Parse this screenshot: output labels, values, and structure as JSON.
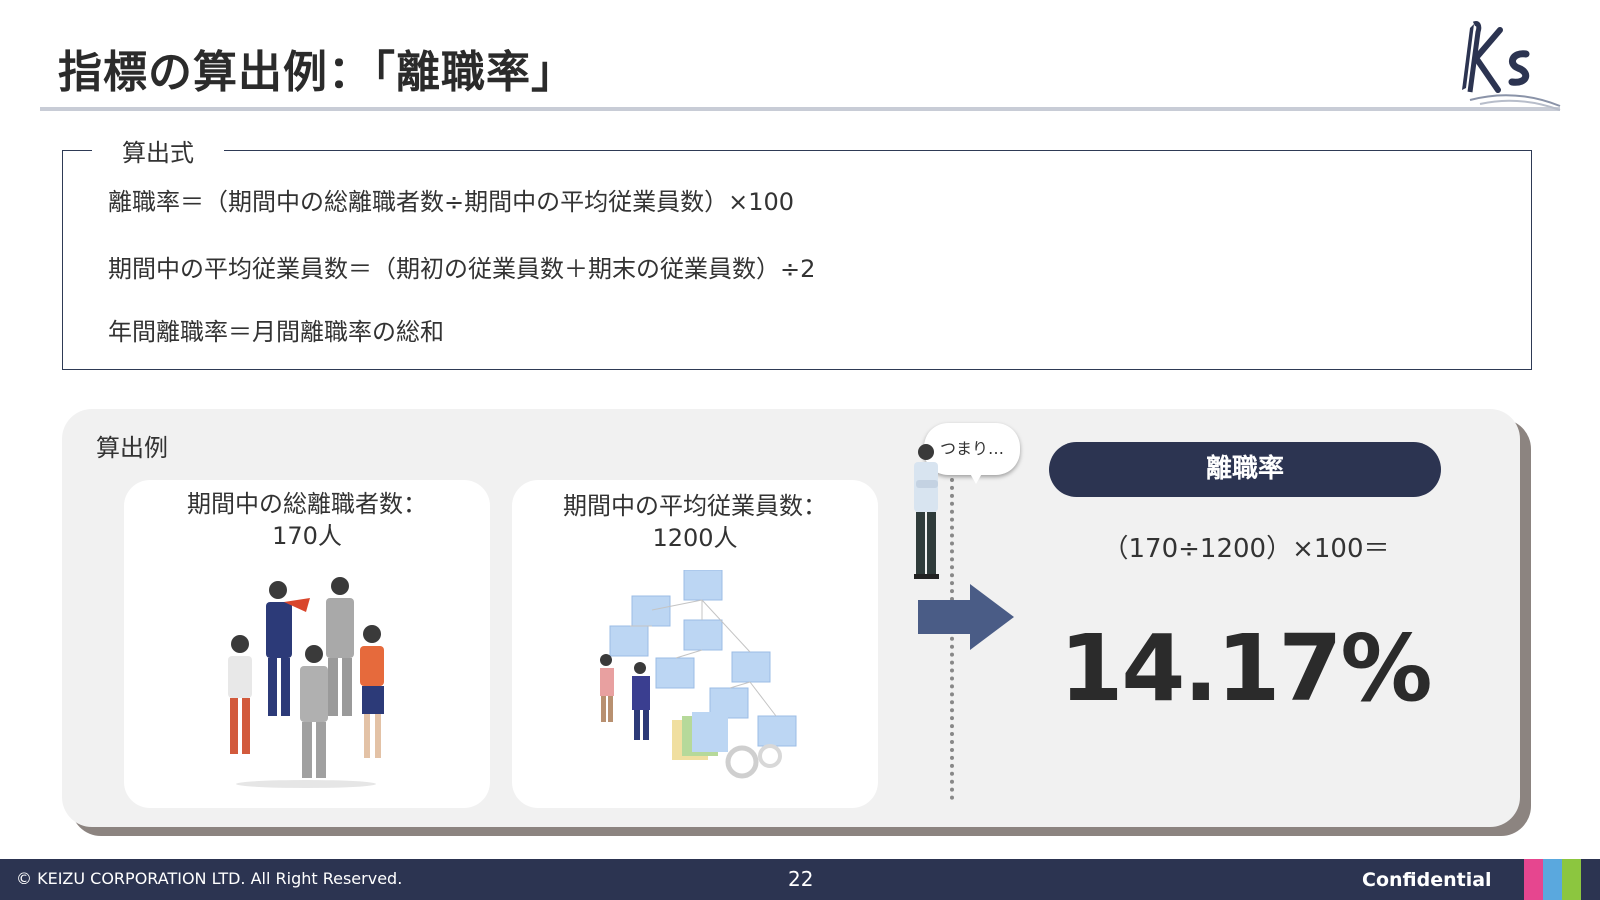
{
  "header": {
    "title": "指標の算出例：「離職率」"
  },
  "formula": {
    "label": "算出式",
    "lines": [
      "離職率＝（期間中の総離職者数÷期間中の平均従業員数）×100",
      "期間中の平均従業員数＝（期初の従業員数＋期末の従業員数）÷2",
      "年間離職率＝月間離職率の総和"
    ]
  },
  "example": {
    "label": "算出例",
    "cards": [
      {
        "line1": "期間中の総離職者数：",
        "line2": "170人"
      },
      {
        "line1": "期間中の平均従業員数：",
        "line2": "1200人"
      }
    ],
    "bubble": "つまり…",
    "result_title": "離職率",
    "calculation": "（170÷1200）×100＝",
    "result_value": "14.17%"
  },
  "footer": {
    "copyright": "© KEIZU CORPORATION LTD. All Right Reserved.",
    "page_number": "22",
    "confidential": "Confidential",
    "stripe_colors": [
      "#e6468f",
      "#5aa8de",
      "#8cc63f"
    ]
  },
  "colors": {
    "navy": "#2c3451",
    "arrow": "#4a5c86",
    "panel": "#f1f1f1"
  }
}
